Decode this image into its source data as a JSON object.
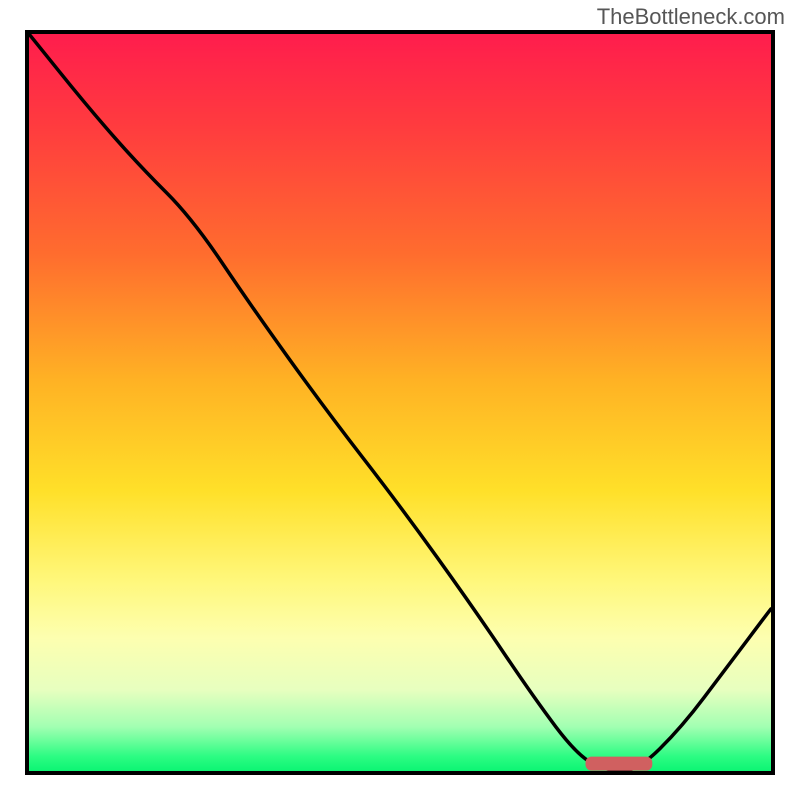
{
  "attribution": "TheBottleneck.com",
  "chart_data": {
    "type": "line",
    "title": "",
    "xlabel": "",
    "ylabel": "",
    "xlim": [
      0,
      100
    ],
    "ylim": [
      0,
      100
    ],
    "grid": false,
    "legend": false,
    "series": [
      {
        "name": "bottleneck-curve",
        "x": [
          0,
          8,
          15,
          22,
          30,
          40,
          50,
          60,
          68,
          74,
          78,
          82,
          88,
          94,
          100
        ],
        "y": [
          100,
          90,
          82,
          75,
          63,
          49,
          36,
          22,
          10,
          2,
          0,
          0,
          6,
          14,
          22
        ]
      }
    ],
    "marker": {
      "x_start": 75,
      "x_end": 84,
      "y": 1
    },
    "background_gradient": {
      "orientation": "vertical",
      "stops": [
        {
          "pos": 0,
          "color": "#ff1d4d"
        },
        {
          "pos": 30,
          "color": "#ff6d2e"
        },
        {
          "pos": 62,
          "color": "#ffe029"
        },
        {
          "pos": 82,
          "color": "#fdffb0"
        },
        {
          "pos": 95,
          "color": "#6dff9c"
        },
        {
          "pos": 100,
          "color": "#0cf573"
        }
      ]
    }
  }
}
